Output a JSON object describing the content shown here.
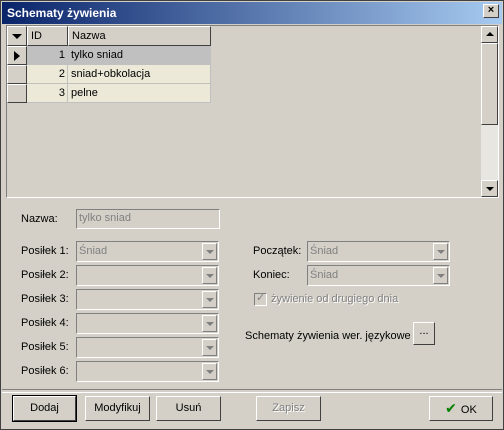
{
  "window": {
    "title": "Schematy żywienia"
  },
  "grid": {
    "columns": [
      "ID",
      "Nazwa"
    ],
    "rows": [
      {
        "id": "1",
        "name": "tylko sniad"
      },
      {
        "id": "2",
        "name": "sniad+obkolacja"
      },
      {
        "id": "3",
        "name": "pelne"
      }
    ]
  },
  "form": {
    "nazwa_label": "Nazwa:",
    "nazwa_value": "tylko sniad",
    "posilek1_label": "Posiłek 1:",
    "posilek1_value": "Śniad",
    "posilek2_label": "Posiłek 2:",
    "posilek2_value": "",
    "posilek3_label": "Posiłek 3:",
    "posilek3_value": "",
    "posilek4_label": "Posiłek 4:",
    "posilek4_value": "",
    "posilek5_label": "Posiłek 5:",
    "posilek5_value": "",
    "posilek6_label": "Posiłek 6:",
    "posilek6_value": "",
    "poczatek_label": "Początek:",
    "poczatek_value": "Śniad",
    "koniec_label": "Koniec:",
    "koniec_value": "Śniad",
    "zywienie_label": "żywienie od drugiego dnia",
    "zywienie_checked": true,
    "lang_label": "Schematy żywienia wer. językowe",
    "lang_button": "..."
  },
  "buttons": {
    "dodaj": "Dodaj",
    "modyfikuj": "Modyfikuj",
    "usun": "Usuń",
    "zapisz": "Zapisz",
    "ok": "OK"
  },
  "colors": {
    "titlebar_start": "#0a246a",
    "titlebar_end": "#a6caf0",
    "selected_row": "#c0c0c0",
    "ok_check": "#008000"
  }
}
